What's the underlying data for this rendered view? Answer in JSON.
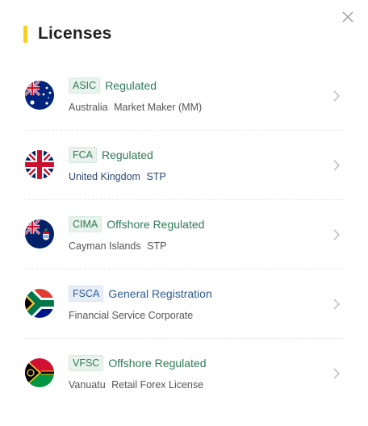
{
  "dialog": {
    "title": "Licenses",
    "accent_color": "#f6d21e",
    "close_icon": "close-icon"
  },
  "licenses": [
    {
      "flag": "australia-flag-icon",
      "code": "ASIC",
      "status": "Regulated",
      "country": "Australia",
      "type": "Market Maker (MM)",
      "color": "green"
    },
    {
      "flag": "uk-flag-icon",
      "code": "FCA",
      "status": "Regulated",
      "country": "United Kingdom",
      "type": "STP",
      "color": "green"
    },
    {
      "flag": "cayman-flag-icon",
      "code": "CIMA",
      "status": "Offshore Regulated",
      "country": "Cayman Islands",
      "type": "STP",
      "color": "green"
    },
    {
      "flag": "south-africa-flag-icon",
      "code": "FSCA",
      "status": "General Registration",
      "country": "Financial Service Corporate",
      "type": "",
      "color": "blue"
    },
    {
      "flag": "vanuatu-flag-icon",
      "code": "VFSC",
      "status": "Offshore Regulated",
      "country": "Vanuatu",
      "type": "Retail Forex License",
      "color": "green"
    }
  ]
}
